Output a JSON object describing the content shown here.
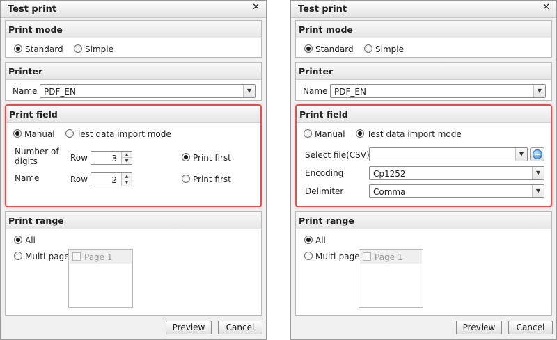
{
  "left": {
    "title": "Test print",
    "close_glyph": "✕",
    "print_mode": {
      "heading": "Print mode",
      "options": [
        "Standard",
        "Simple"
      ],
      "selected": "Standard"
    },
    "printer": {
      "heading": "Printer",
      "name_label": "Name",
      "value": "PDF_EN"
    },
    "print_field": {
      "heading": "Print field",
      "options": [
        "Manual",
        "Test data import mode"
      ],
      "selected": "Manual",
      "rows": [
        {
          "label": "Number of digits",
          "row_label": "Row",
          "value": "3",
          "print_first": "Print first",
          "selected": true
        },
        {
          "label": "Name",
          "row_label": "Row",
          "value": "2",
          "print_first": "Print first",
          "selected": false
        }
      ]
    },
    "print_range": {
      "heading": "Print range",
      "options": [
        "All",
        "Multi-page"
      ],
      "selected": "All",
      "pages": [
        "Page 1"
      ]
    },
    "buttons": {
      "preview": "Preview",
      "cancel": "Cancel"
    }
  },
  "right": {
    "title": "Test print",
    "close_glyph": "✕",
    "print_mode": {
      "heading": "Print mode",
      "options": [
        "Standard",
        "Simple"
      ],
      "selected": "Standard"
    },
    "printer": {
      "heading": "Printer",
      "name_label": "Name",
      "value": "PDF_EN"
    },
    "print_field": {
      "heading": "Print field",
      "options": [
        "Manual",
        "Test data import mode"
      ],
      "selected": "Test data import mode",
      "select_file_label": "Select file(CSV)",
      "select_file_value": "",
      "encoding_label": "Encoding",
      "encoding_value": "Cp1252",
      "delimiter_label": "Delimiter",
      "delimiter_value": "Comma"
    },
    "print_range": {
      "heading": "Print range",
      "options": [
        "All",
        "Multi-page"
      ],
      "selected": "All",
      "pages": [
        "Page 1"
      ]
    },
    "buttons": {
      "preview": "Preview",
      "cancel": "Cancel"
    }
  },
  "colors": {
    "highlight_border": "#e05050",
    "dialog_bg": "#f0f0f0"
  },
  "icons": {
    "close": "close-icon",
    "dropdown": "chevron-down-icon",
    "browse": "globe-browse-icon"
  }
}
